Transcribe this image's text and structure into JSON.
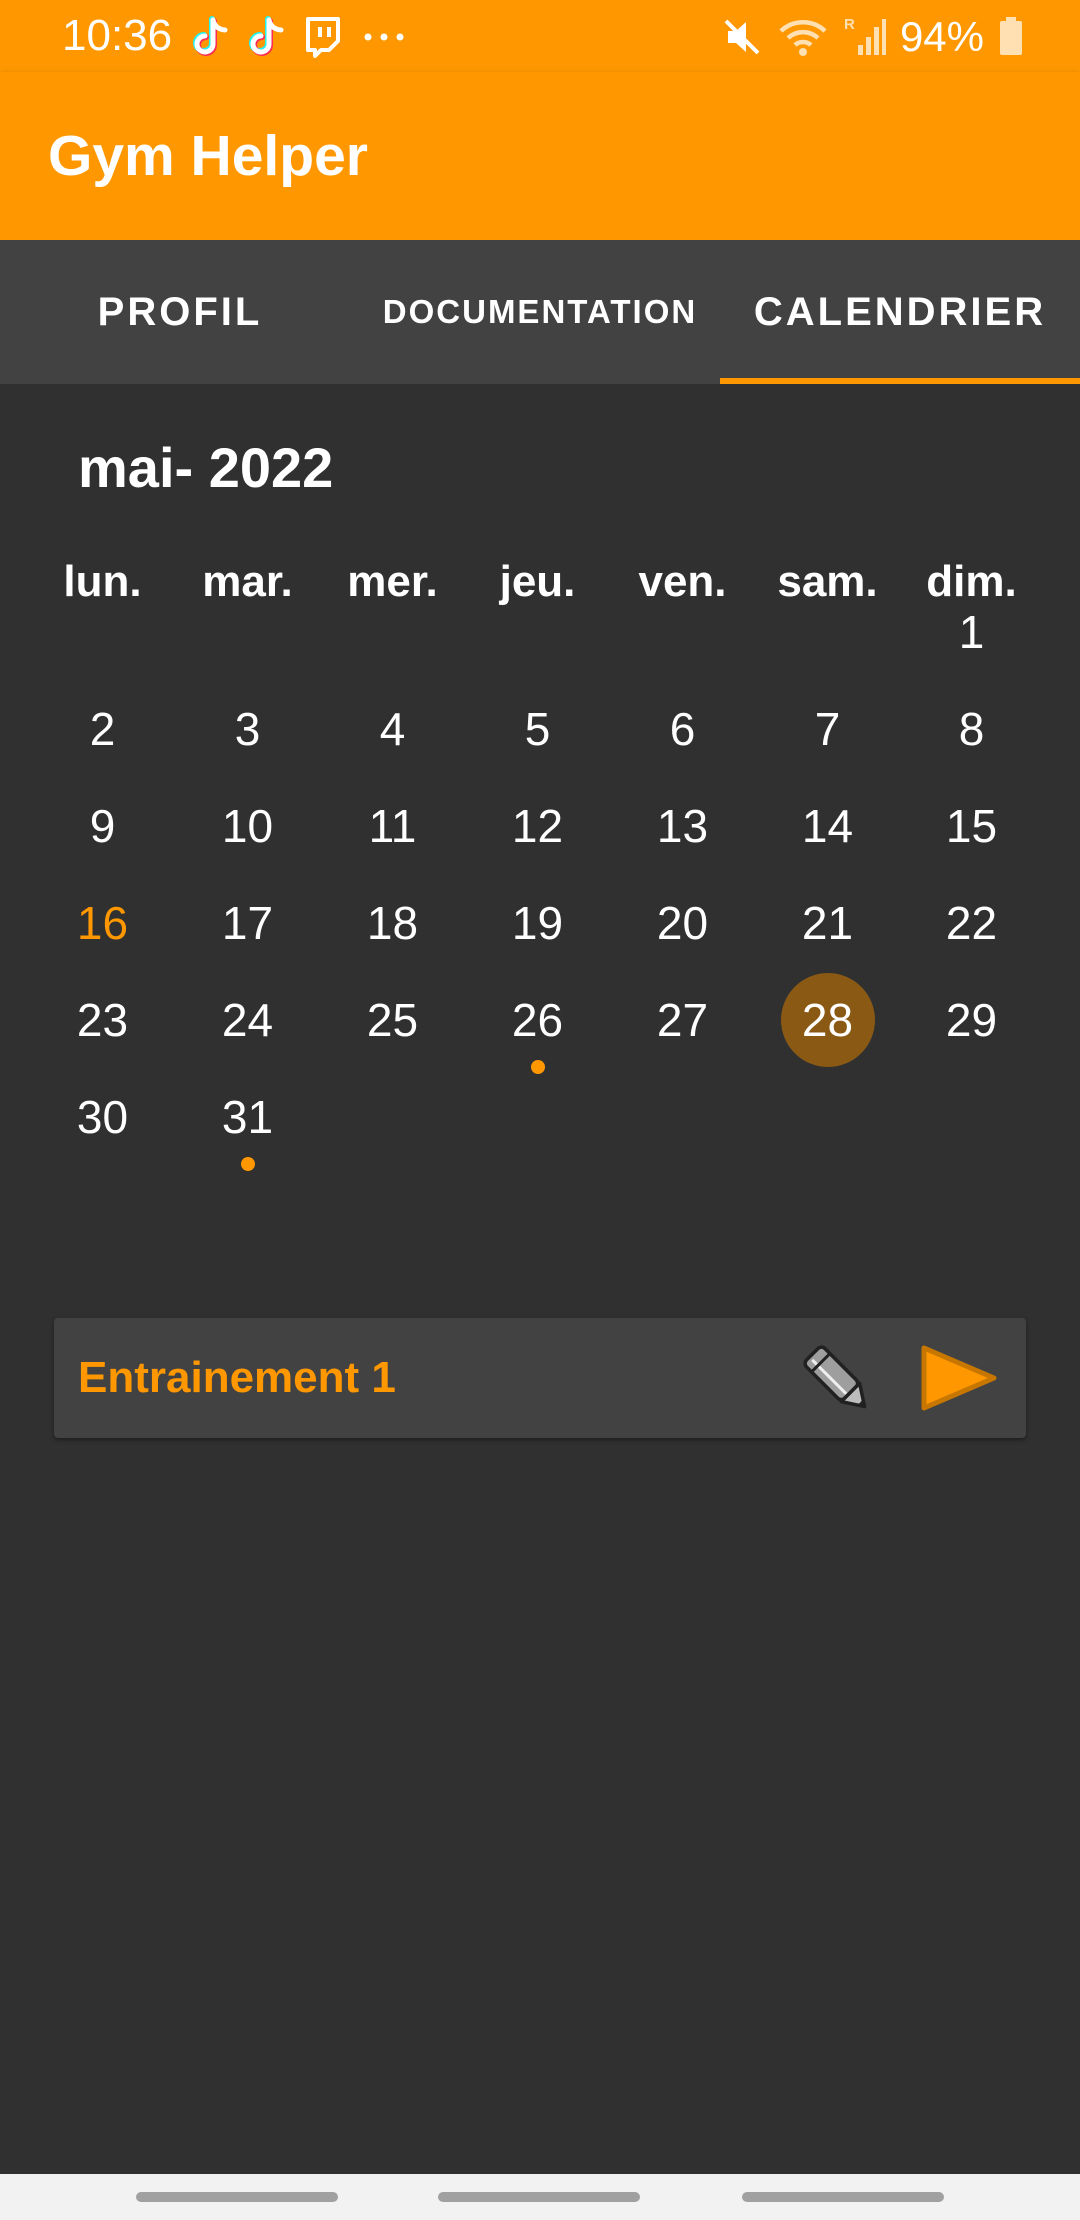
{
  "status_bar": {
    "time": "10:36",
    "left_icons": [
      "tiktok-icon",
      "tiktok-icon",
      "twitch-icon",
      "more-dots-icon"
    ],
    "right_icons": [
      "mute-icon",
      "wifi-icon",
      "signal-icon",
      "battery-icon"
    ],
    "signal_roaming_label": "R",
    "battery": "94%"
  },
  "app_bar": {
    "title": "Gym Helper",
    "color": "#ff9800"
  },
  "tabs": [
    {
      "label": "PROFIL",
      "selected": false
    },
    {
      "label": "DOCUMENTATION",
      "selected": false
    },
    {
      "label": "CALENDRIER",
      "selected": true
    }
  ],
  "calendar": {
    "month_label": "mai- 2022",
    "weekdays": [
      "lun.",
      "mar.",
      "mer.",
      "jeu.",
      "ven.",
      "sam.",
      "dim."
    ],
    "days": [
      "1",
      "2",
      "3",
      "4",
      "5",
      "6",
      "7",
      "8",
      "9",
      "10",
      "11",
      "12",
      "13",
      "14",
      "15",
      "16",
      "17",
      "18",
      "19",
      "20",
      "21",
      "22",
      "23",
      "24",
      "25",
      "26",
      "27",
      "28",
      "29",
      "30",
      "31"
    ],
    "first_weekday_index": 6,
    "today": "16",
    "selected": "28",
    "days_with_events": [
      "26",
      "31"
    ],
    "accent_color": "#ff9800",
    "selected_color": "#8a5a14"
  },
  "workouts": [
    {
      "name": "Entrainement 1",
      "edit_icon": "pencil-icon",
      "start_icon": "play-icon"
    }
  ]
}
